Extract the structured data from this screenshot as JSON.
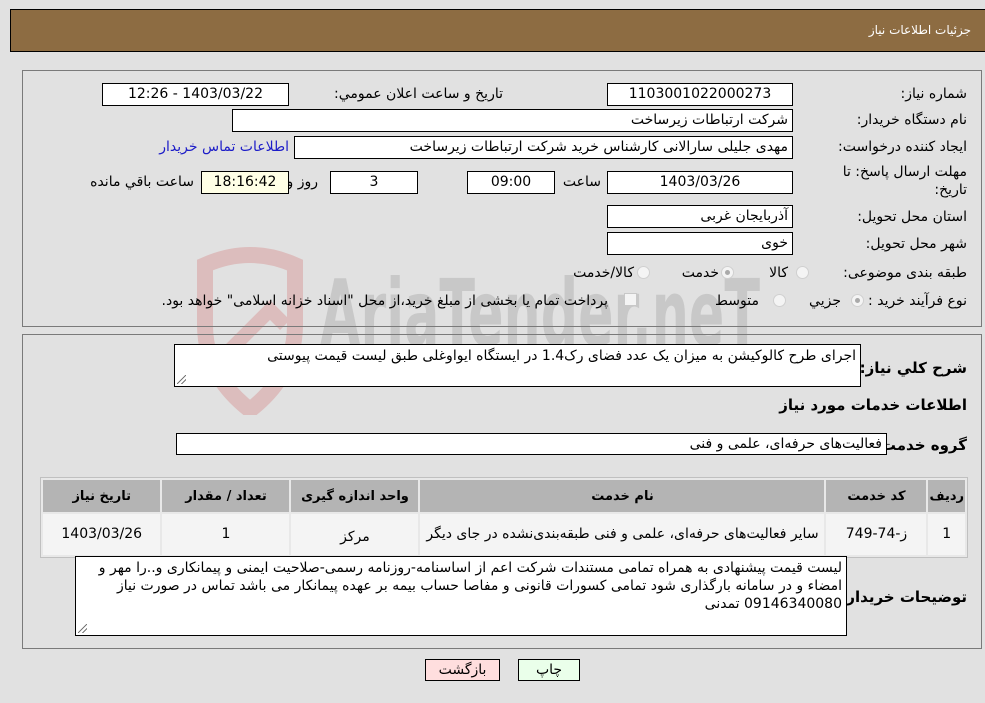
{
  "header": {
    "title": "جزئیات اطلاعات نیاز"
  },
  "form": {
    "need_number_label": "شماره نیاز:",
    "need_number": "1103001022000273",
    "announce_label": "تاریخ و ساعت اعلان عمومي:",
    "announce_value": "1403/03/22 - 12:26",
    "buyer_org_label": "نام دستگاه خریدار:",
    "buyer_org": "شرکت ارتباطات زیرساخت",
    "creator_label": "ایجاد کننده درخواست:",
    "creator": "مهدی جلیلی سارالانی کارشناس خرید شرکت ارتباطات زیرساخت",
    "contact_link": "اطلاعات تماس خریدار",
    "deadline_label_1": "مهلت ارسال پاسخ: تا",
    "deadline_label_2": "تاریخ:",
    "deadline_date": "1403/03/26",
    "time_label": "ساعت",
    "deadline_time": "09:00",
    "days": "3",
    "days_label": "روز و",
    "remaining_time": "18:16:42",
    "remaining_label": "ساعت باقي مانده",
    "province_label": "استان محل تحویل:",
    "province": "آذربایجان غربی",
    "city_label": "شهر محل تحویل:",
    "city": "خوی",
    "category_label": "طبقه بندی موضوعی:",
    "category_options": [
      "کالا",
      "خدمت",
      "کالا/خدمت"
    ],
    "category_selected": "خدمت",
    "process_label": "نوع فرآیند خرید :",
    "process_options": [
      "جزيي",
      "متوسط"
    ],
    "process_selected": "جزيي",
    "treasury_note": "پرداخت تمام یا بخشی از مبلغ خرید،از محل \"اسناد خزانه اسلامی\" خواهد بود."
  },
  "details": {
    "summary_label": "شرح کلي نياز:",
    "summary": "اجرای طرح کالوکیشن به میزان یک عدد فضای رک1.4 در ایستگاه ایواوغلی طبق لیست قیمت پیوستی",
    "services_heading": "اطلاعات خدمات مورد نیاز",
    "service_group_label": "گروه خدمت:",
    "service_group": "فعالیت‌های حرفه‌ای، علمی و فنی",
    "table": {
      "headers": [
        "ردیف",
        "کد خدمت",
        "نام خدمت",
        "واحد اندازه گیری",
        "تعداد / مقدار",
        "تاریخ نیاز"
      ],
      "rows": [
        [
          "1",
          "ز-74-749",
          "سایر فعالیت‌های حرفه‌ای، علمی و فنی طبقه‌بندی‌نشده در جای دیگر",
          "مرکز",
          "1",
          "1403/03/26"
        ]
      ]
    },
    "buyer_notes_label": "توضیحات خریدار:",
    "buyer_notes": "لیست قیمت پیشنهادی به همراه تمامی مستندات شرکت اعم از اساسنامه-روزنامه رسمی-صلاحیت ایمنی و پیمانکاری و..را مهر و امضاء و در سامانه بارگذاری شود تمامی کسورات قانونی و مفاصا حساب بیمه بر عهده پیمانکار می باشد تماس در صورت نیاز 09146340080 تمدنی"
  },
  "buttons": {
    "print": "چاپ",
    "back": "بازگشت"
  },
  "watermark": {
    "text": "AriaTender.neT"
  },
  "colors": {
    "header_bg": "#8d6c42",
    "print_bg": "#eaffea",
    "back_bg": "#ffdede",
    "link": "#1c1cc8"
  }
}
